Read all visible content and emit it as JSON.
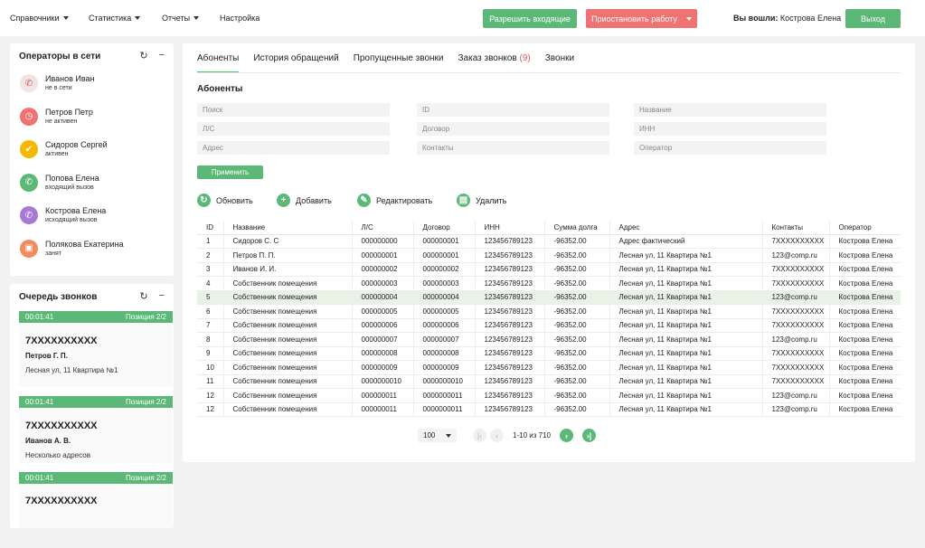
{
  "nav": {
    "menu": [
      {
        "label": "Справочники",
        "caret": true
      },
      {
        "label": "Статистика",
        "caret": true
      },
      {
        "label": "Отчеты",
        "caret": true
      },
      {
        "label": "Настройка",
        "caret": false
      }
    ],
    "allow_incoming": "Разрешить входящие",
    "pause_work": "Приостановить работу",
    "logged_label": "Вы вошли:",
    "logged_user": "Кострова Елена",
    "logout": "Выход"
  },
  "operators": {
    "title": "Операторы в сети",
    "items": [
      {
        "name": "Иванов Иван",
        "status": "не в сети",
        "color": "#f1e4e4",
        "icon_color": "#e05a5a",
        "icon": "offline-icon",
        "glyph": "✆"
      },
      {
        "name": "Петров Петр",
        "status": "не активен",
        "color": "#f07373",
        "icon_color": "#ffffff",
        "icon": "clock-icon",
        "glyph": "◷"
      },
      {
        "name": "Сидоров Сергей",
        "status": "активен",
        "color": "#f5b800",
        "icon_color": "#ffffff",
        "icon": "thumbs-up-icon",
        "glyph": "✔"
      },
      {
        "name": "Попова Елена",
        "status": "входящий вызов",
        "color": "#5cb877",
        "icon_color": "#ffffff",
        "icon": "incoming-call-icon",
        "glyph": "✆"
      },
      {
        "name": "Кострова Елена",
        "status": "исходящий вызов",
        "color": "#a77ad6",
        "icon_color": "#ffffff",
        "icon": "outgoing-call-icon",
        "glyph": "✆"
      },
      {
        "name": "Полякова Екатерина",
        "status": "занят",
        "color": "#f28c5a",
        "icon_color": "#ffffff",
        "icon": "briefcase-icon",
        "glyph": "▣"
      }
    ]
  },
  "queue": {
    "title": "Очередь звонков",
    "items": [
      {
        "time": "00:01:41",
        "position": "Позиция 2/2",
        "phone": "7XXXXXXXXXX",
        "name": "Петров Г. П.",
        "address": "Лесная ул, 11 Квартира №1"
      },
      {
        "time": "00:01:41",
        "position": "Позиция 2/2",
        "phone": "7XXXXXXXXXX",
        "name": "Иванов А. В.",
        "address": "Несколько адресов"
      },
      {
        "time": "00:01:41",
        "position": "Позиция 2/2",
        "phone": "7XXXXXXXXXX",
        "name": "",
        "address": ""
      }
    ]
  },
  "main": {
    "tabs": [
      {
        "label": "Абоненты",
        "count": ""
      },
      {
        "label": "История обращений",
        "count": ""
      },
      {
        "label": "Пропущенные звонки",
        "count": ""
      },
      {
        "label": "Заказ звонков",
        "count": "(9)"
      },
      {
        "label": "Звонки",
        "count": ""
      }
    ],
    "section_title": "Абоненты",
    "filters": [
      "Поиск",
      "ID",
      "Название",
      "Л/С",
      "Договор",
      "ИНН",
      "Адрес",
      "Контакты",
      "Оператор"
    ],
    "apply": "Применить",
    "actions": {
      "refresh": "Обновить",
      "add": "Добавить",
      "edit": "Редактировать",
      "delete": "Удалить"
    },
    "table": {
      "columns": [
        "ID",
        "Название",
        "Л/С",
        "Договор",
        "ИНН",
        "Сумма долга",
        "Адрес",
        "Контакты",
        "Оператор"
      ],
      "rows": [
        [
          "1",
          "Сидоров С. С",
          "000000000",
          "000000001",
          "123456789123",
          "-96352.00",
          "Адрес фактический",
          "7XXXXXXXXXX",
          "Кострова Елена"
        ],
        [
          "2",
          "Петров П. П.",
          "000000001",
          "000000001",
          "123456789123",
          "-96352.00",
          "Лесная ул, 11 Квартира №1",
          "123@comp.ru",
          "Кострова Елена"
        ],
        [
          "3",
          "Иванов И. И.",
          "000000002",
          "000000002",
          "123456789123",
          "-96352.00",
          "Лесная ул, 11 Квартира №1",
          "7XXXXXXXXXX",
          "Кострова Елена"
        ],
        [
          "4",
          "Собственник помещения",
          "000000003",
          "000000003",
          "123456789123",
          "-96352.00",
          "Лесная ул, 11 Квартира №1",
          "7XXXXXXXXXX",
          "Кострова Елена"
        ],
        [
          "5",
          "Собственник помещения",
          "000000004",
          "000000004",
          "123456789123",
          "-96352.00",
          "Лесная ул, 11 Квартира №1",
          "123@comp.ru",
          "Кострова Елена"
        ],
        [
          "6",
          "Собственник помещения",
          "000000005",
          "000000005",
          "123456789123",
          "-96352.00",
          "Лесная ул, 11 Квартира №1",
          "7XXXXXXXXXX",
          "Кострова Елена"
        ],
        [
          "7",
          "Собственник помещения",
          "000000006",
          "000000006",
          "123456789123",
          "-96352.00",
          "Лесная ул, 11 Квартира №1",
          "7XXXXXXXXXX",
          "Кострова Елена"
        ],
        [
          "8",
          "Собственник помещения",
          "000000007",
          "000000007",
          "123456789123",
          "-96352.00",
          "Лесная ул, 11 Квартира №1",
          "123@comp.ru",
          "Кострова Елена"
        ],
        [
          "9",
          "Собственник помещения",
          "000000008",
          "000000008",
          "123456789123",
          "-96352.00",
          "Лесная ул, 11 Квартира №1",
          "7XXXXXXXXXX",
          "Кострова Елена"
        ],
        [
          "10",
          "Собственник помещения",
          "000000009",
          "000000009",
          "123456789123",
          "-96352.00",
          "Лесная ул, 11 Квартира №1",
          "7XXXXXXXXXX",
          "Кострова Елена"
        ],
        [
          "11",
          "Собственник помещения",
          "0000000010",
          "0000000010",
          "123456789123",
          "-96352.00",
          "Лесная ул, 11 Квартира №1",
          "7XXXXXXXXXX",
          "Кострова Елена"
        ],
        [
          "12",
          "Собственник помещения",
          "000000011",
          "0000000011",
          "123456789123",
          "-96352.00",
          "Лесная ул, 11 Квартира №1",
          "123@comp.ru",
          "Кострова Елена"
        ],
        [
          "12",
          "Собственник помещения",
          "000000011",
          "0000000011",
          "123456789123",
          "-96352.00",
          "Лесная ул, 11 Квартира №1",
          "123@comp.ru",
          "Кострова Елена"
        ]
      ],
      "highlighted_row": 4
    },
    "pager": {
      "per_page": "100",
      "range": "1-10 из 710"
    }
  },
  "colors": {
    "accent": "#5cb877",
    "danger": "#f07373"
  }
}
